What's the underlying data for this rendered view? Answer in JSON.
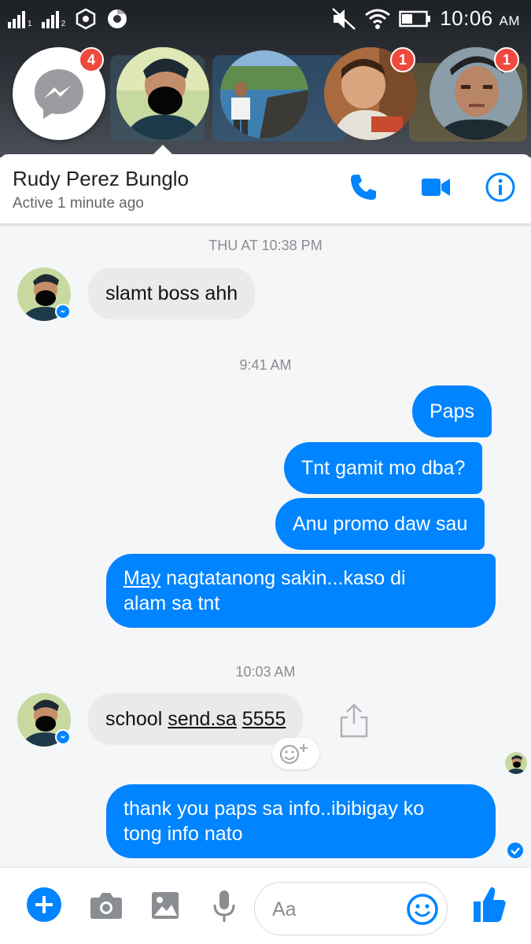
{
  "statusbar": {
    "sim1": "1",
    "sim2": "2",
    "time": "10:06",
    "ampm": "AM"
  },
  "chat_heads": {
    "messenger_badge": "4",
    "head4_badge": "1",
    "head5_badge": "1"
  },
  "header": {
    "name": "Rudy Perez Bunglo",
    "status": "Active 1 minute ago"
  },
  "thread": {
    "ts1": "THU AT 10:38 PM",
    "msg1": "slamt boss ahh",
    "ts2": "9:41 AM",
    "msg2": "Paps",
    "msg3": "Tnt gamit mo dba?",
    "msg4": "Anu promo daw sau",
    "msg5_link": "May",
    "msg5_line1": " nagtatanong sakin...kaso di",
    "msg5_line2": "alam sa tnt",
    "ts3": "10:03 AM",
    "msg6_a": "school ",
    "msg6_link1": "send.sa",
    "msg6_link2": "5555",
    "msg7_line1": "thank you paps sa info..ibibigay ko",
    "msg7_line2": "tong info nato"
  },
  "composer": {
    "placeholder": "Aa"
  },
  "colors": {
    "accent": "#0084ff",
    "badge": "#f0493e",
    "incoming_bubble": "#e9eaeb"
  }
}
